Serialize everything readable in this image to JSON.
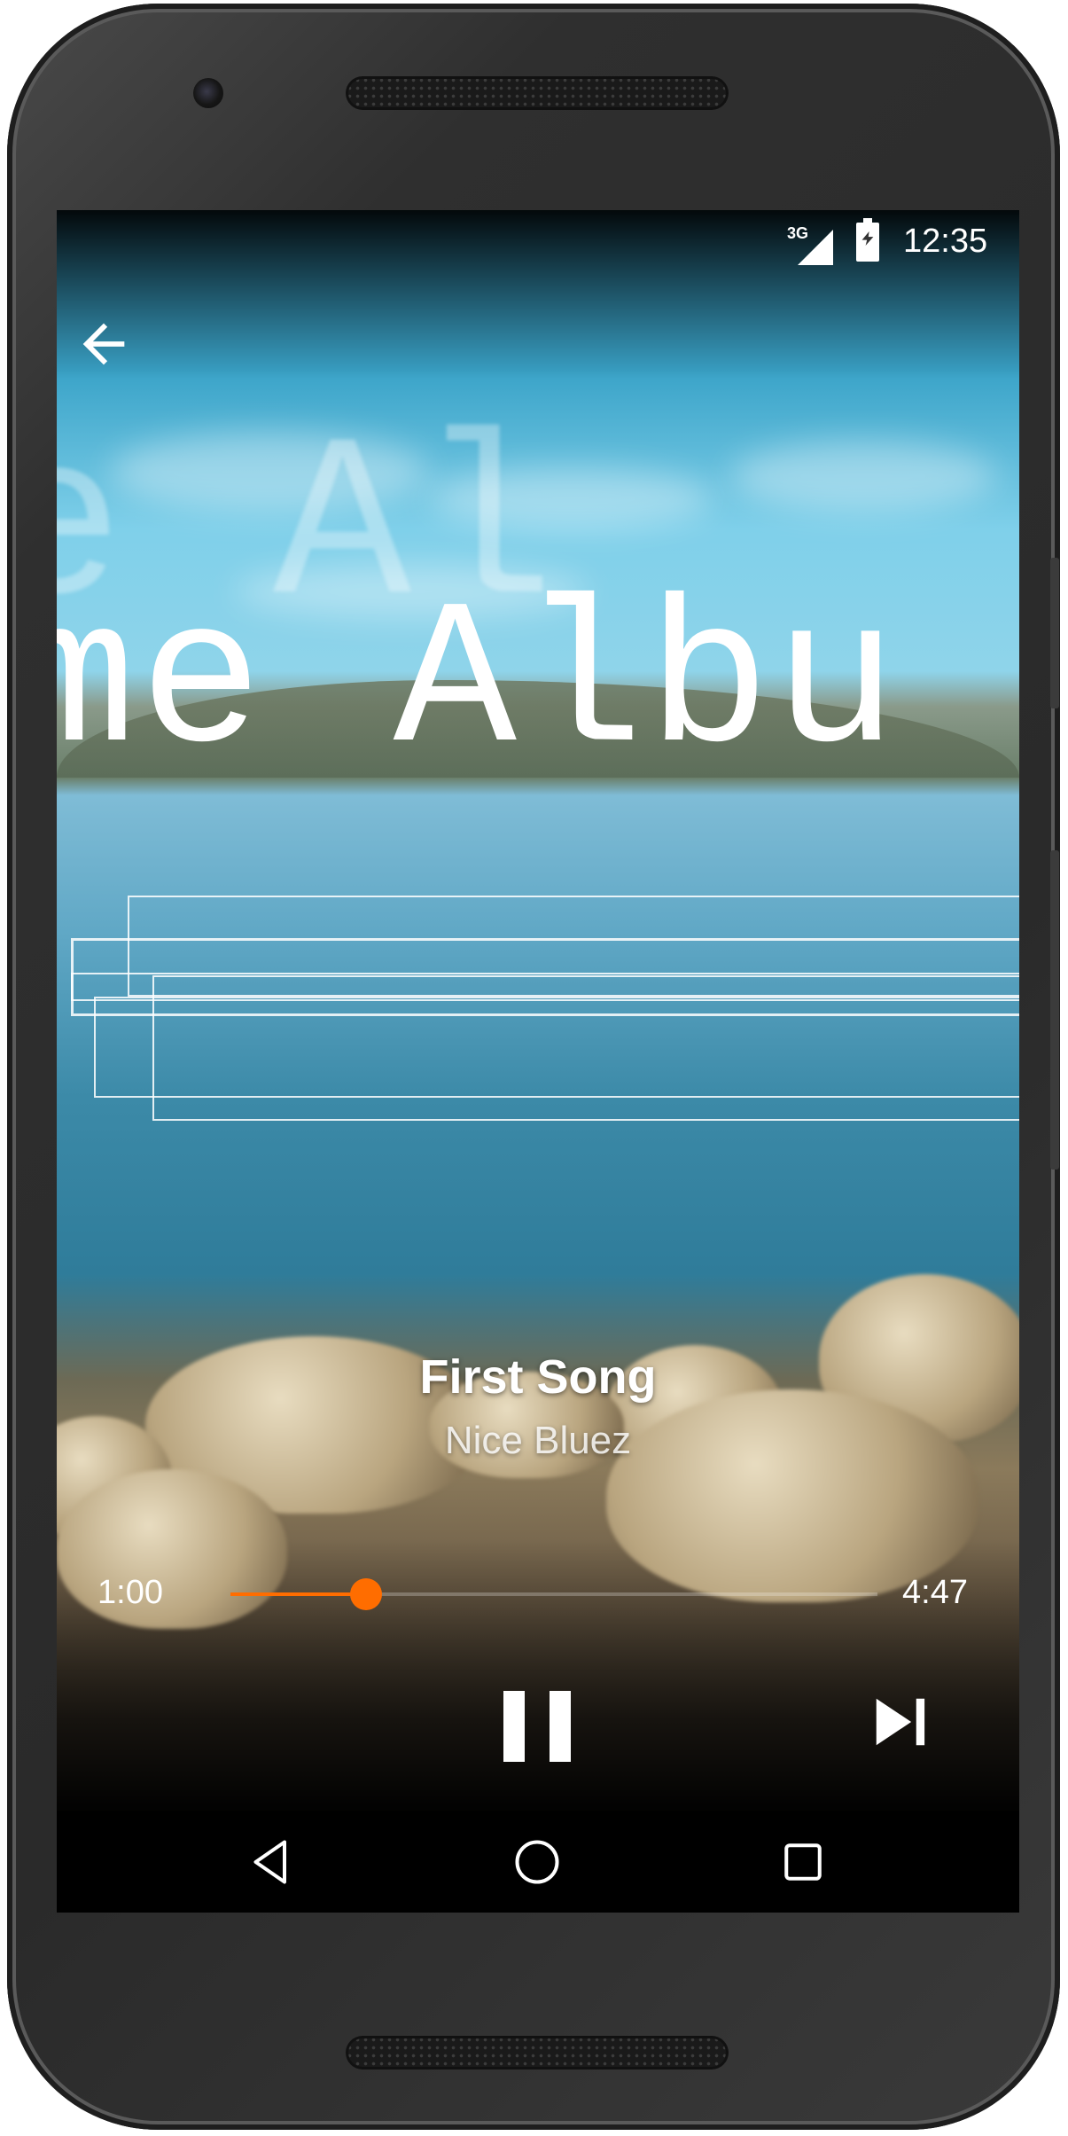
{
  "status_bar": {
    "network": "3G",
    "time": "12:35",
    "icons": [
      "signal-icon",
      "battery-charging-icon"
    ]
  },
  "toolbar": {
    "back_icon": "arrow-back-icon"
  },
  "album_art": {
    "text": "me Albu",
    "ghost_text": "e Al"
  },
  "now_playing": {
    "title": "First Song",
    "artist": "Nice Bluez"
  },
  "player": {
    "elapsed": "1:00",
    "duration": "4:47",
    "progress_fraction": 0.209,
    "accent_color": "#ff6d00",
    "controls": [
      "pause-icon",
      "skip-next-icon"
    ]
  },
  "nav_bar": {
    "icons": [
      "nav-back-icon",
      "nav-home-icon",
      "nav-recents-icon"
    ]
  }
}
